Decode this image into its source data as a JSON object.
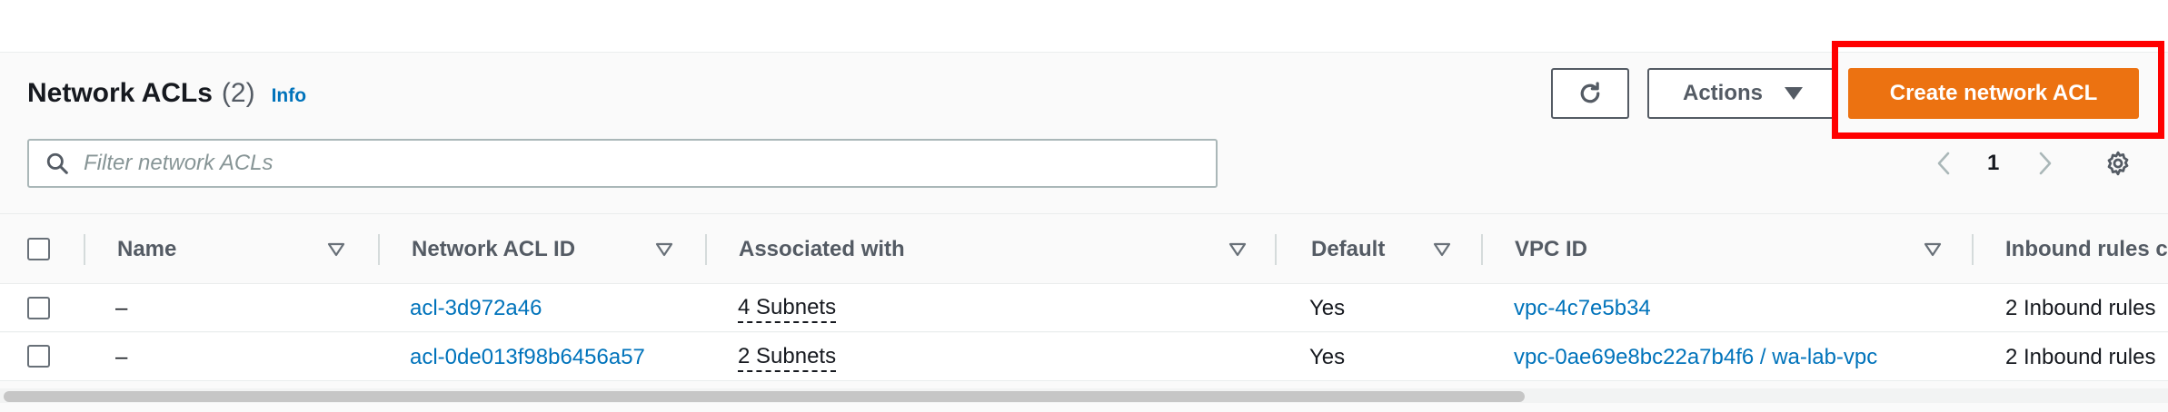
{
  "header": {
    "title": "Network ACLs",
    "count": "(2)",
    "info": "Info"
  },
  "toolbar": {
    "refresh_icon": "refresh-icon",
    "actions_label": "Actions",
    "create_label": "Create network ACL"
  },
  "search": {
    "placeholder": "Filter network ACLs",
    "value": ""
  },
  "pagination": {
    "current_page": "1"
  },
  "table": {
    "columns": [
      "Name",
      "Network ACL ID",
      "Associated with",
      "Default",
      "VPC ID",
      "Inbound rules c"
    ],
    "rows": [
      {
        "name": "–",
        "acl_id": "acl-3d972a46",
        "associated": "4 Subnets",
        "default": "Yes",
        "vpc_id": "vpc-4c7e5b34",
        "inbound": "2 Inbound rules"
      },
      {
        "name": "–",
        "acl_id": "acl-0de013f98b6456a57",
        "associated": "2 Subnets",
        "default": "Yes",
        "vpc_id": "vpc-0ae69e8bc22a7b4f6 / wa-lab-vpc",
        "inbound": "2 Inbound rules"
      }
    ]
  },
  "colors": {
    "primary_button": "#ec7211",
    "link": "#0073bb",
    "highlight": "#ff0000"
  }
}
